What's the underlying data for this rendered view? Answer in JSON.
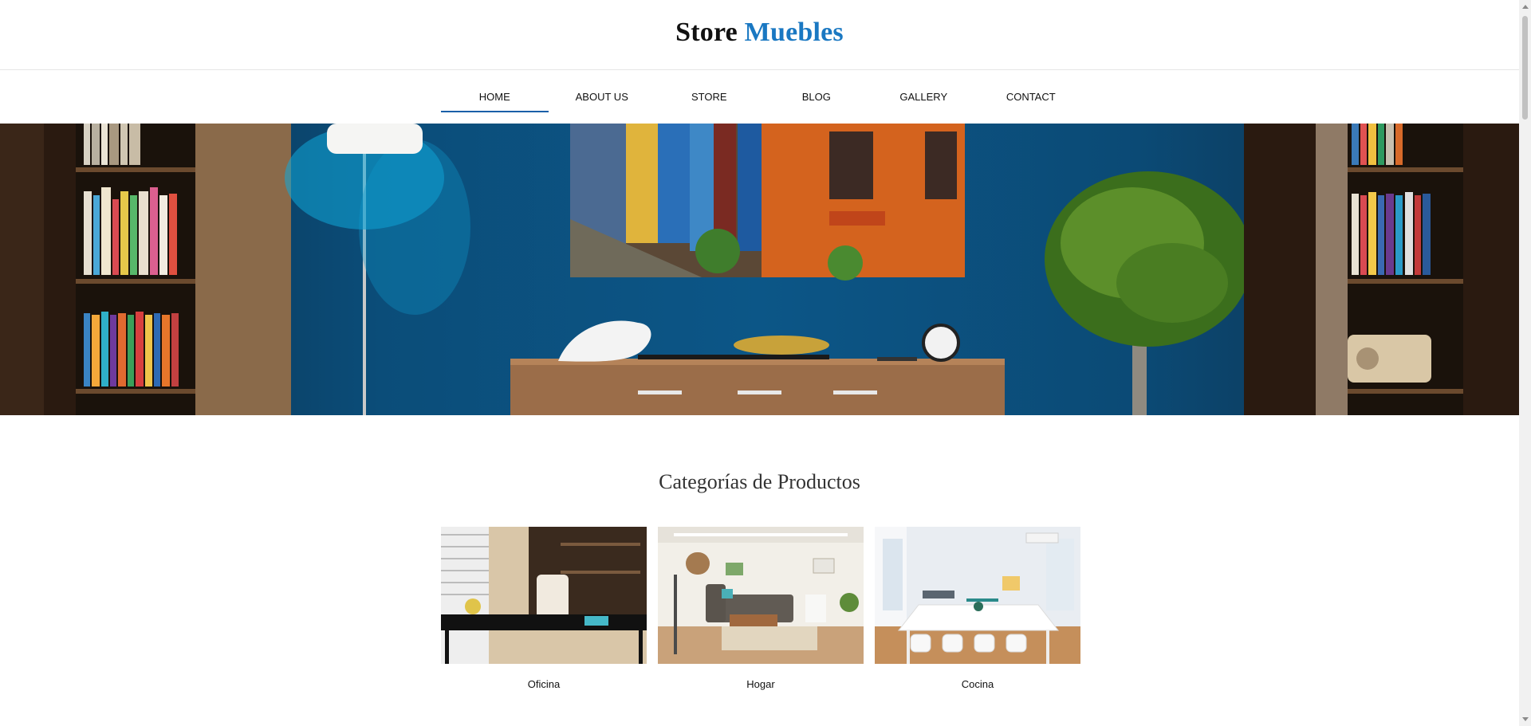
{
  "header": {
    "logo_part1": "Store",
    "logo_part2": "Muebles"
  },
  "nav": {
    "items": [
      {
        "label": "HOME"
      },
      {
        "label": "ABOUT US"
      },
      {
        "label": "STORE"
      },
      {
        "label": "BLOG"
      },
      {
        "label": "GALLERY"
      },
      {
        "label": "CONTACT"
      }
    ],
    "active": "HOME"
  },
  "categories": {
    "title": "Categorías de Productos",
    "items": [
      {
        "label": "Oficina"
      },
      {
        "label": "Hogar"
      },
      {
        "label": "Cocina"
      }
    ]
  },
  "colors": {
    "brand_accent": "#1a78c2",
    "active_underline": "#1a5fa8"
  }
}
